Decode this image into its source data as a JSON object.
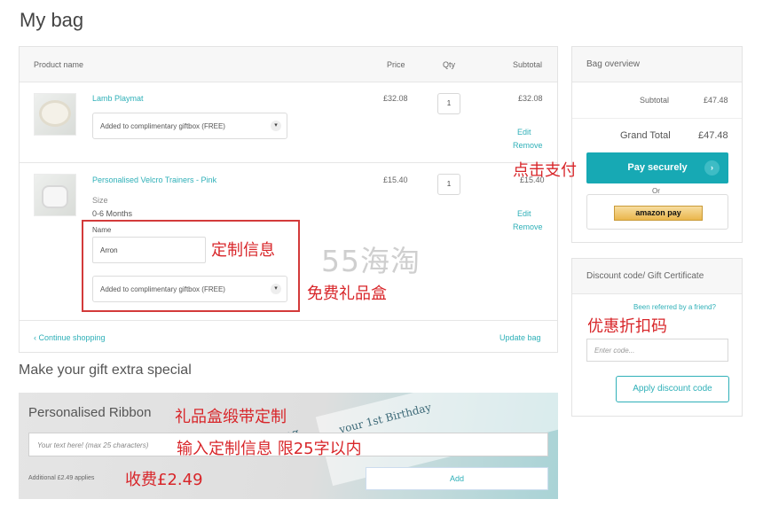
{
  "page": {
    "title": "My bag"
  },
  "bag": {
    "headers": {
      "product": "Product name",
      "price": "Price",
      "qty": "Qty",
      "subtotal": "Subtotal"
    },
    "items": [
      {
        "name": "Lamb Playmat",
        "gift_option": "Added to complimentary giftbox (FREE)",
        "price": "£32.08",
        "qty": "1",
        "subtotal": "£32.08",
        "edit": "Edit",
        "remove": "Remove"
      },
      {
        "name": "Personalised Velcro Trainers - Pink",
        "size_label": "Size",
        "size_value": "0-6 Months",
        "name_label": "Name",
        "name_value": "Arron",
        "gift_option": "Added to complimentary giftbox (FREE)",
        "price": "£15.40",
        "qty": "1",
        "subtotal": "£15.40",
        "edit": "Edit",
        "remove": "Remove"
      }
    ],
    "continue_shopping": "‹ Continue shopping",
    "update_bag": "Update bag"
  },
  "gift": {
    "title": "Make your gift extra special",
    "ribbon_title": "Personalised Ribbon",
    "input_placeholder": "Your text here! (max 25 characters)",
    "fee_text": "Additional £2.49 applies",
    "add_label": "Add",
    "decor_text": "your 1st Birthday",
    "decor_text2": "Cong"
  },
  "overview": {
    "title": "Bag overview",
    "subtotal_label": "Subtotal",
    "subtotal_value": "£47.48",
    "grand_total_label": "Grand Total",
    "grand_total_value": "£47.48",
    "pay_label": "Pay securely",
    "or_label": "Or",
    "amazon_label": "amazon pay"
  },
  "discount": {
    "title": "Discount code/ Gift Certificate",
    "referred_link": "Been referred by a friend?",
    "input_placeholder": "Enter code...",
    "apply_label": "Apply discount code"
  },
  "annotations": {
    "pay": "点击支付",
    "custom_info": "定制信息",
    "free_giftbox": "免费礼品盒",
    "discount_code": "优惠折扣码",
    "ribbon_custom": "礼品盒缎带定制",
    "input_limit": "输入定制信息 限25字以内",
    "fee": "收费£2.49",
    "watermark": "55海淘"
  },
  "icons": {
    "chevron": "chevron-down-icon",
    "arrow": "arrow-right-icon"
  },
  "colors": {
    "accent": "#2fb0b8",
    "pay_button": "#17a9b4",
    "annotation": "#d8262a"
  }
}
